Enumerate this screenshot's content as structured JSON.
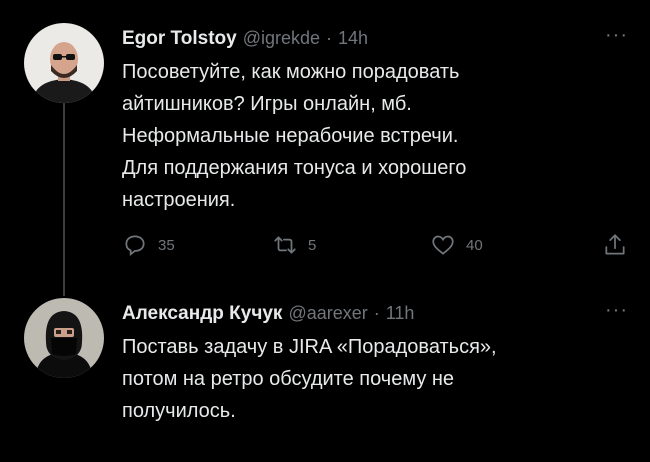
{
  "tweets": [
    {
      "display_name": "Egor Tolstoy",
      "handle": "@igrekde",
      "separator": "·",
      "time": "14h",
      "more_label": "···",
      "lines": [
        "Посоветуйте, как можно порадовать",
        "айтишников? Игры онлайн, мб.",
        "Неформальные нерабочие встречи.",
        "Для поддержания тонуса и хорошего",
        "настроения."
      ],
      "actions": {
        "reply_count": "35",
        "retweet_count": "5",
        "like_count": "40"
      }
    },
    {
      "display_name": "Александр Кучук",
      "handle": "@aarexer",
      "separator": "·",
      "time": "11h",
      "more_label": "···",
      "lines": [
        "Поставь задачу в JIRA «Порадоваться»,",
        "потом на ретро обсудите почему не",
        "получилось."
      ]
    }
  ],
  "icons": [
    "reply-icon",
    "retweet-icon",
    "like-icon",
    "share-icon"
  ],
  "colors": {
    "background": "#000000",
    "text": "#e7e9ea",
    "muted": "#71767b"
  }
}
